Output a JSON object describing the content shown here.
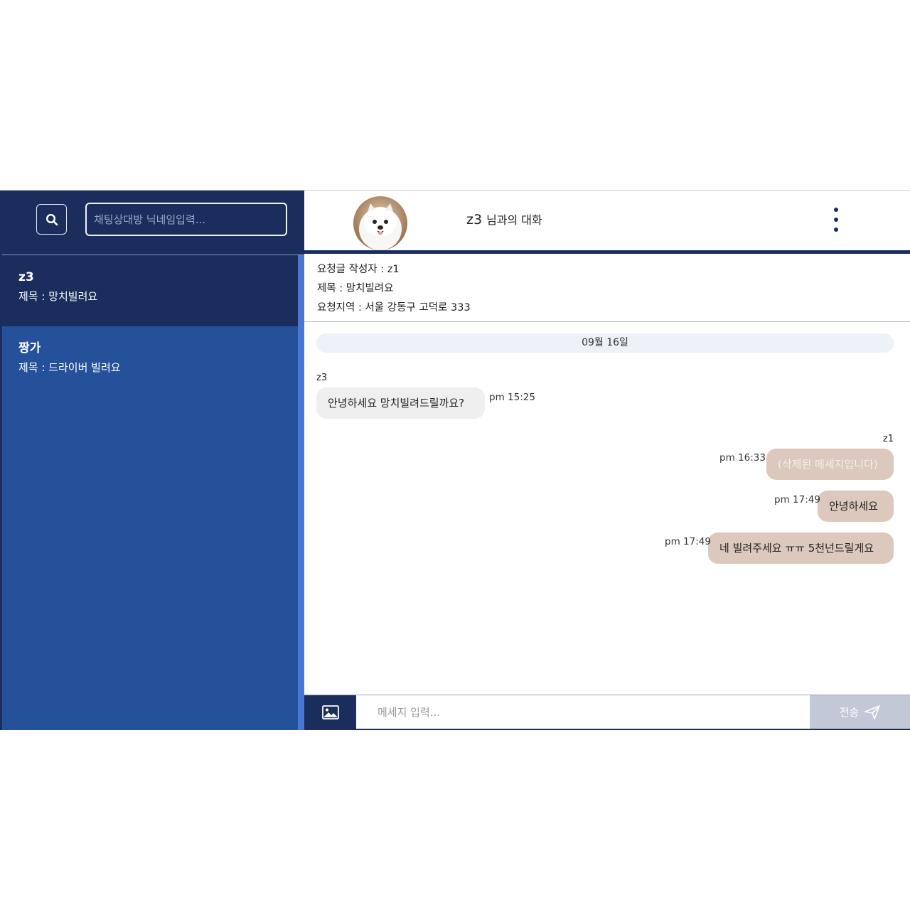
{
  "search": {
    "placeholder": "채팅상대방 닉네임입력..."
  },
  "rooms": [
    {
      "name": "z3",
      "title": "제목 : 망치빌려요",
      "active": true
    },
    {
      "name": "짱가",
      "title": "제목 : 드라이버 빌려요",
      "active": false
    }
  ],
  "header": {
    "partner": "z3",
    "suffix": "님과의 대화"
  },
  "info": {
    "author": "요청글 작성자 : z1",
    "title": "제목 : 망치빌려요",
    "region": "요청지역 : 서울 강동구 고덕로 333"
  },
  "date": "09월 16일",
  "messages": [
    {
      "sender": "z3",
      "text": "안녕하세요 망치빌려드릴까요?",
      "time": "pm 15:25",
      "direction": "in"
    },
    {
      "sender": "z1",
      "text": "(삭제된 메세지입니다)",
      "time": "pm 16:33",
      "direction": "out",
      "deleted": true
    },
    {
      "text": "안녕하세요",
      "time": "pm 17:49",
      "direction": "out"
    },
    {
      "text": "네 빌려주세요 ㅠㅠ 5천넌드릴게요",
      "time": "pm 17:49",
      "direction": "out"
    }
  ],
  "composer": {
    "placeholder": "메세지 입력...",
    "send_label": "전송"
  },
  "icons": {
    "search": "search-icon",
    "more": "more-vertical-icon",
    "image": "image-icon",
    "send": "send-icon"
  },
  "colors": {
    "navy": "#1a2d5c",
    "sidebar_blue": "#25519a",
    "scrollbar": "#4a78d1",
    "bubble_out": "#dcc8bc",
    "bubble_in": "#efefef",
    "send_button": "#c2c8d6"
  }
}
